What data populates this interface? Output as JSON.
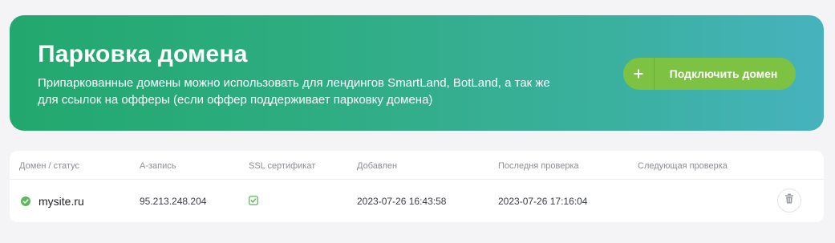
{
  "banner": {
    "title": "Парковка домена",
    "description_line1": "Припаркованные домены можно использовать для лендингов SmartLand, BotLand, а так же",
    "description_line2": "для ссылок на офферы (если оффер поддерживает парковку домена)",
    "connect_button_label": "Подключить домен",
    "connect_button_icon": "plus-icon",
    "gradient_colors": [
      "#22a86e",
      "#46b3bd"
    ],
    "button_color": "#7dc243"
  },
  "table": {
    "headers": {
      "domain_status": "Домен / статус",
      "a_record": "А-запись",
      "ssl": "SSL сертификат",
      "added": "Добавлен",
      "last_check": "Последня проверка",
      "next_check": "Следующая проверка"
    },
    "rows": [
      {
        "status_icon": "status-ok-icon",
        "status_color": "#5cb85c",
        "domain": "mysite.ru",
        "a_record": "95.213.248.204",
        "ssl_icon": "ssl-check-icon",
        "added": "2023-07-26 16:43:58",
        "last_check": "2023-07-26 17:16:04",
        "next_check": "",
        "delete_icon": "trash-icon"
      }
    ]
  }
}
